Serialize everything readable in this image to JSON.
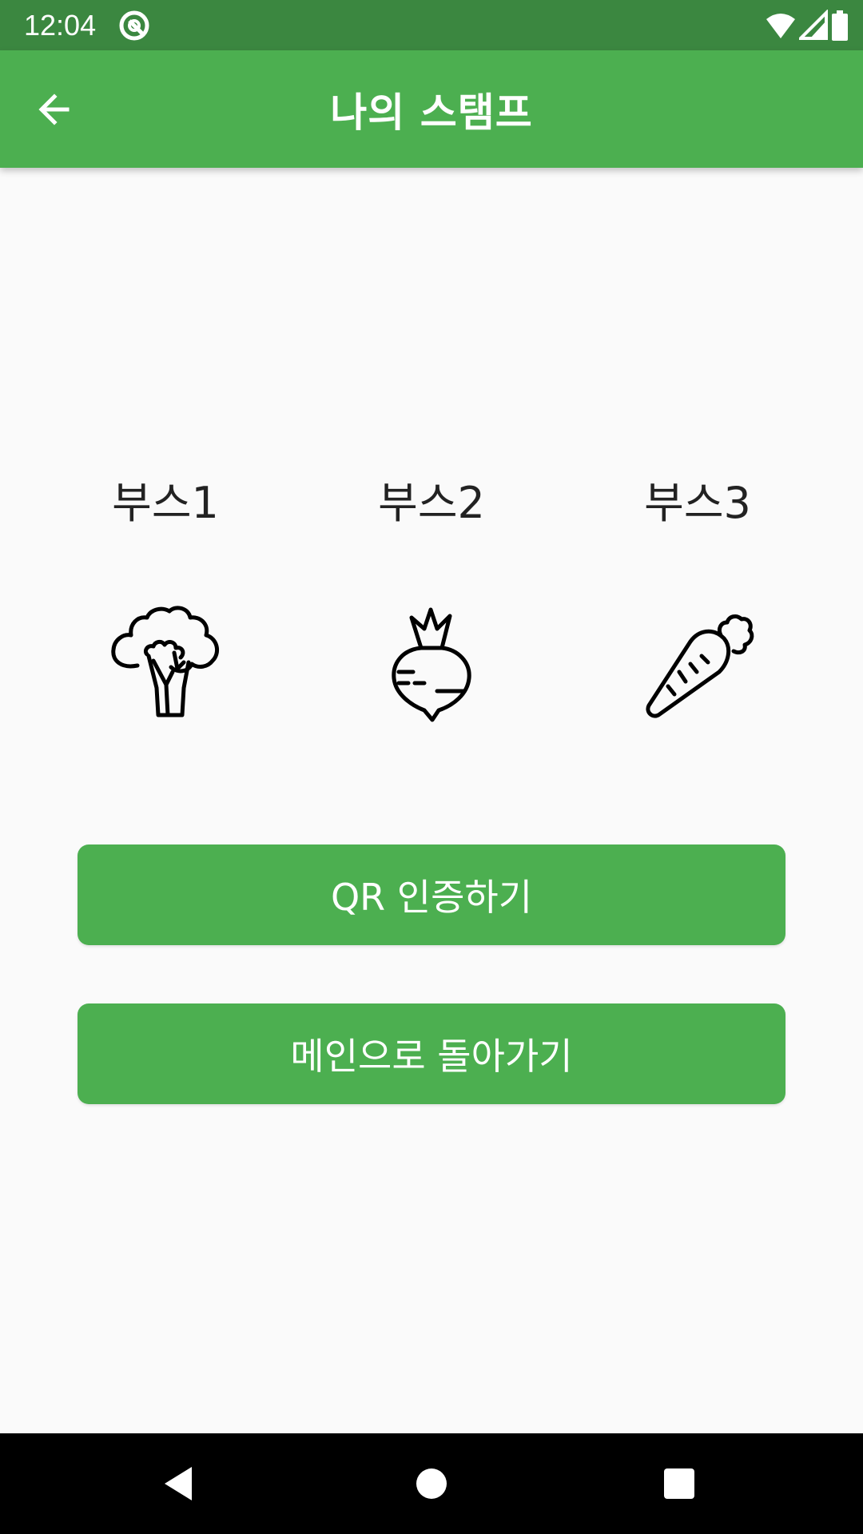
{
  "status_bar": {
    "time": "12:04"
  },
  "app_bar": {
    "title": "나의 스탬프",
    "back_icon": "arrow-left-icon"
  },
  "booths": [
    {
      "label": "부스1",
      "icon": "broccoli-icon"
    },
    {
      "label": "부스2",
      "icon": "radish-icon"
    },
    {
      "label": "부스3",
      "icon": "carrot-icon"
    }
  ],
  "buttons": {
    "qr_label": "QR 인증하기",
    "main_label": "메인으로 돌아가기"
  },
  "colors": {
    "status_bar": "#3b8740",
    "primary": "#4caf50",
    "background": "#fafafa",
    "nav_bar": "#000000"
  },
  "nav_bar": {
    "back_icon": "triangle-back-icon",
    "home_icon": "circle-home-icon",
    "recents_icon": "square-recents-icon"
  }
}
